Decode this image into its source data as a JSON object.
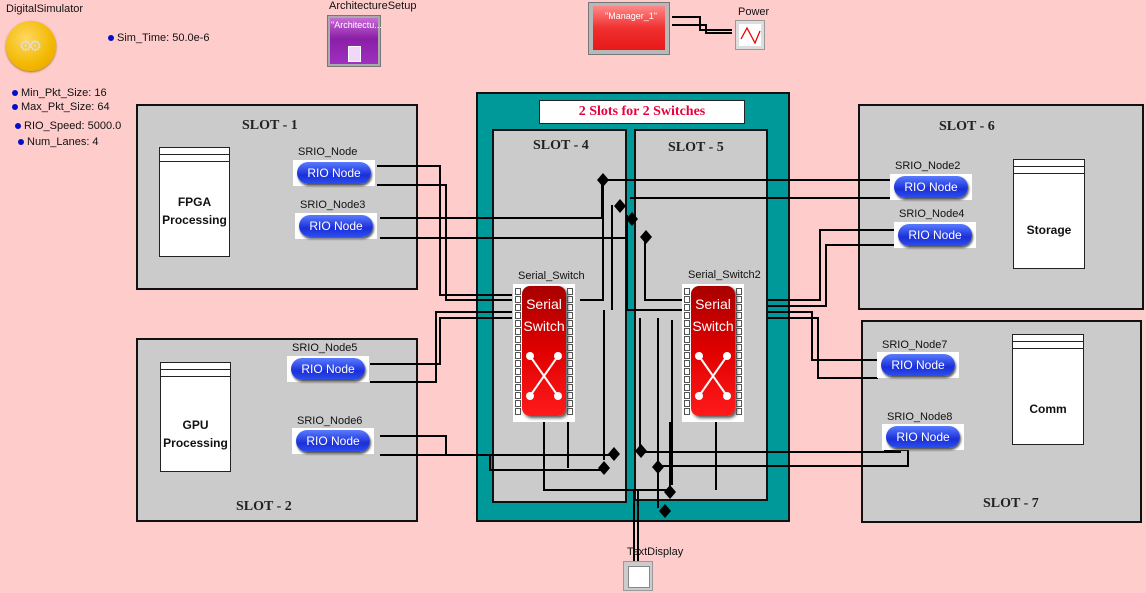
{
  "simulator": {
    "title": "DigitalSimulator",
    "params": [
      {
        "name": "Sim_Time",
        "text": "Sim_Time: 50.0e-6"
      },
      {
        "name": "Min_Pkt_Size",
        "text": "Min_Pkt_Size: 16"
      },
      {
        "name": "Max_Pkt_Size",
        "text": "Max_Pkt_Size: 64"
      },
      {
        "name": "RIO_Speed",
        "text": "RIO_Speed: 5000.0"
      },
      {
        "name": "Num_Lanes",
        "text": "Num_Lanes: 4"
      }
    ]
  },
  "architecture_setup": {
    "title": "ArchitectureSetup",
    "block_text": "\"Architectu..."
  },
  "manager": {
    "block_text": "\"Manager_1\""
  },
  "power": {
    "title": "Power"
  },
  "text_display": {
    "title": "TextDisplay"
  },
  "switch_group": {
    "banner": "2 Slots for 2 Switches",
    "banner_color": "#e8003a",
    "bg_color": "#009999"
  },
  "slots": {
    "slot1": {
      "title": "SLOT - 1",
      "block_lines": [
        "FPGA",
        "Processing"
      ]
    },
    "slot2": {
      "title": "SLOT - 2",
      "block_lines": [
        "GPU",
        "Processing"
      ]
    },
    "slot4": {
      "title": "SLOT - 4"
    },
    "slot5": {
      "title": "SLOT - 5"
    },
    "slot6": {
      "title": "SLOT - 6",
      "block_lines": [
        "Storage"
      ]
    },
    "slot7": {
      "title": "SLOT - 7",
      "block_lines": [
        "Comm"
      ]
    }
  },
  "rio_nodes": [
    {
      "name": "SRIO_Node",
      "label": "RIO Node"
    },
    {
      "name": "SRIO_Node3",
      "label": "RIO Node"
    },
    {
      "name": "SRIO_Node5",
      "label": "RIO Node"
    },
    {
      "name": "SRIO_Node6",
      "label": "RIO Node"
    },
    {
      "name": "SRIO_Node2",
      "label": "RIO Node"
    },
    {
      "name": "SRIO_Node4",
      "label": "RIO Node"
    },
    {
      "name": "SRIO_Node7",
      "label": "RIO Node"
    },
    {
      "name": "SRIO_Node8",
      "label": "RIO Node"
    }
  ],
  "switches": [
    {
      "name": "Serial_Switch",
      "line1": "Serial",
      "line2": "Switch"
    },
    {
      "name": "Serial_Switch2",
      "line1": "Serial",
      "line2": "Switch"
    }
  ]
}
